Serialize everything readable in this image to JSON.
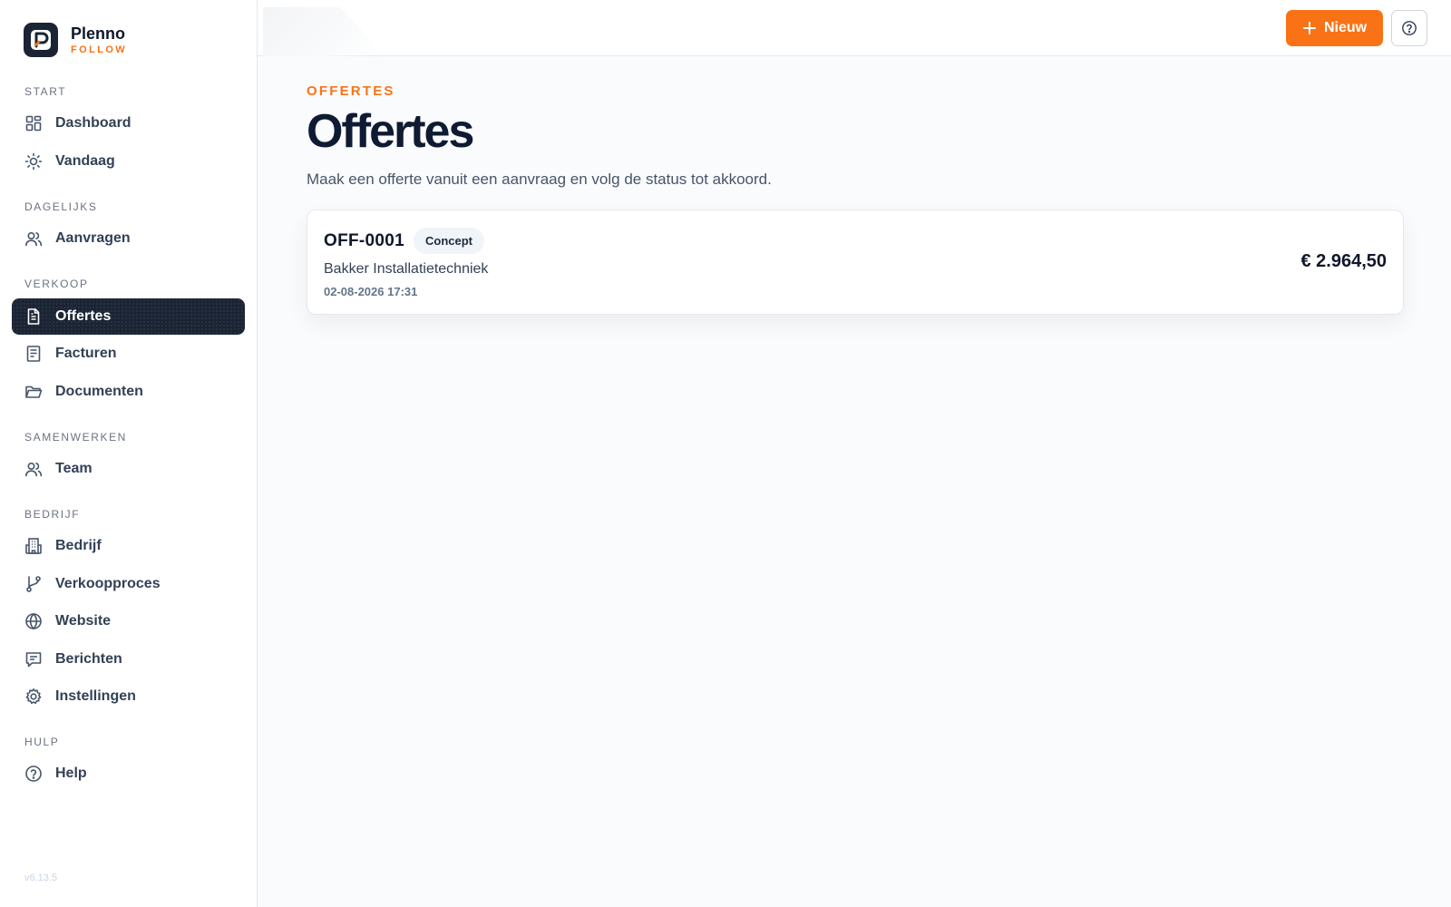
{
  "brand": {
    "name": "Plenno",
    "sub": "FOLLOW"
  },
  "sidebar": {
    "sections": [
      {
        "label": "START",
        "items": [
          {
            "label": "Dashboard",
            "icon": "dashboard-icon"
          },
          {
            "label": "Vandaag",
            "icon": "sun-icon"
          }
        ]
      },
      {
        "label": "DAGELIJKS",
        "items": [
          {
            "label": "Aanvragen",
            "icon": "users-icon"
          }
        ]
      },
      {
        "label": "VERKOOP",
        "items": [
          {
            "label": "Offertes",
            "icon": "document-icon",
            "active": true
          },
          {
            "label": "Facturen",
            "icon": "invoice-icon"
          },
          {
            "label": "Documenten",
            "icon": "folder-icon"
          }
        ]
      },
      {
        "label": "SAMENWERKEN",
        "items": [
          {
            "label": "Team",
            "icon": "users-icon"
          }
        ]
      },
      {
        "label": "BEDRIJF",
        "items": [
          {
            "label": "Bedrijf",
            "icon": "building-icon"
          },
          {
            "label": "Verkoopproces",
            "icon": "git-branch-icon"
          },
          {
            "label": "Website",
            "icon": "globe-icon"
          },
          {
            "label": "Berichten",
            "icon": "message-icon"
          },
          {
            "label": "Instellingen",
            "icon": "gear-icon"
          }
        ]
      },
      {
        "label": "HULP",
        "items": [
          {
            "label": "Help",
            "icon": "help-circle-icon"
          }
        ]
      }
    ],
    "version": "v6.13.5"
  },
  "topbar": {
    "new_label": "Nieuw"
  },
  "page": {
    "eyebrow": "OFFERTES",
    "title": "Offertes",
    "subtitle": "Maak een offerte vanuit een aanvraag en volg de status tot akkoord."
  },
  "quotes": [
    {
      "id": "OFF-0001",
      "status": "Concept",
      "client": "Bakker Installatietechniek",
      "date": "02-08-2026 17:31",
      "amount": "€ 2.964,50"
    }
  ],
  "colors": {
    "accent": "#f97316",
    "active_nav": "#1b2434"
  }
}
